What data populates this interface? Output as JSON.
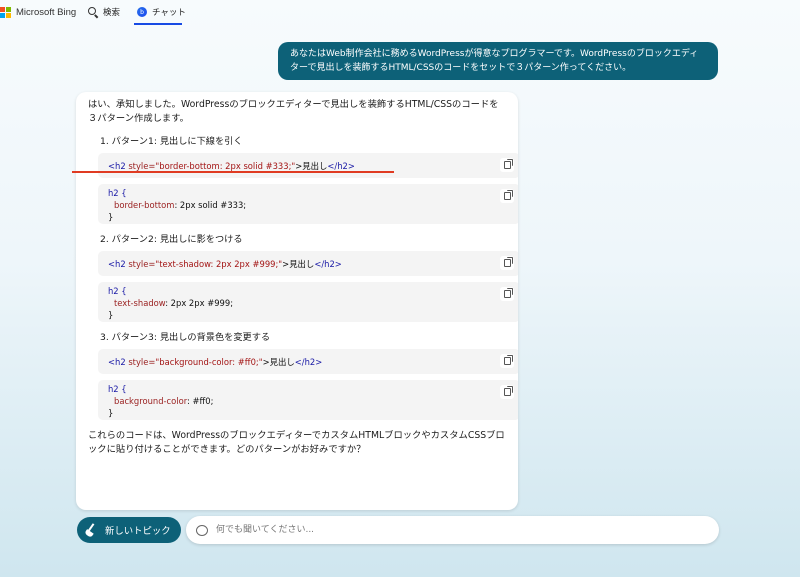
{
  "header": {
    "brand": "Microsoft Bing",
    "nav_search": "検索",
    "nav_chat": "チャット"
  },
  "user_message": "あなたはWeb制作会社に務めるWordPressが得意なプログラマーです。WordPressのブロックエディターで見出しを装飾するHTML/CSSのコードをセットで３パターン作ってください。",
  "bot": {
    "intro": "はい、承知しました。WordPressのブロックエディターで見出しを装飾するHTML/CSSのコードを３パターン作成します。",
    "patterns": [
      {
        "title": "1. パターン1: 見出しに下線を引く",
        "html": {
          "open": "<h2",
          "attr": " style=",
          "value": "\"border-bottom: 2px solid #333;\"",
          "close": ">",
          "text": "見出し",
          "end": "</h2>"
        },
        "css": {
          "selector": "h2 {",
          "prop": "border-bottom",
          "value": ": 2px solid #333;",
          "end": "}"
        }
      },
      {
        "title": "2. パターン2: 見出しに影をつける",
        "html": {
          "open": "<h2",
          "attr": " style=",
          "value": "\"text-shadow: 2px 2px #999;\"",
          "close": ">",
          "text": "見出し",
          "end": "</h2>"
        },
        "css": {
          "selector": "h2 {",
          "prop": "text-shadow",
          "value": ": 2px 2px #999;",
          "end": "}"
        }
      },
      {
        "title": "3. パターン3: 見出しの背景色を変更する",
        "html": {
          "open": "<h2",
          "attr": " style=",
          "value": "\"background-color: #ff0;\"",
          "close": ">",
          "text": "見出し",
          "end": "</h2>"
        },
        "css": {
          "selector": "h2 {",
          "prop": "background-color",
          "value": ": #ff0;",
          "end": "}"
        }
      }
    ],
    "outro": "これらのコードは、WordPressのブロックエディターでカスタムHTMLブロックやカスタムCSSブロックに貼り付けることができます。どのパターンがお好みですか？"
  },
  "composer": {
    "new_topic_label": "新しいトピック",
    "placeholder": "何でも聞いてください..."
  },
  "colors": {
    "accent": "#0d6178",
    "highlight": "#e03b22"
  }
}
